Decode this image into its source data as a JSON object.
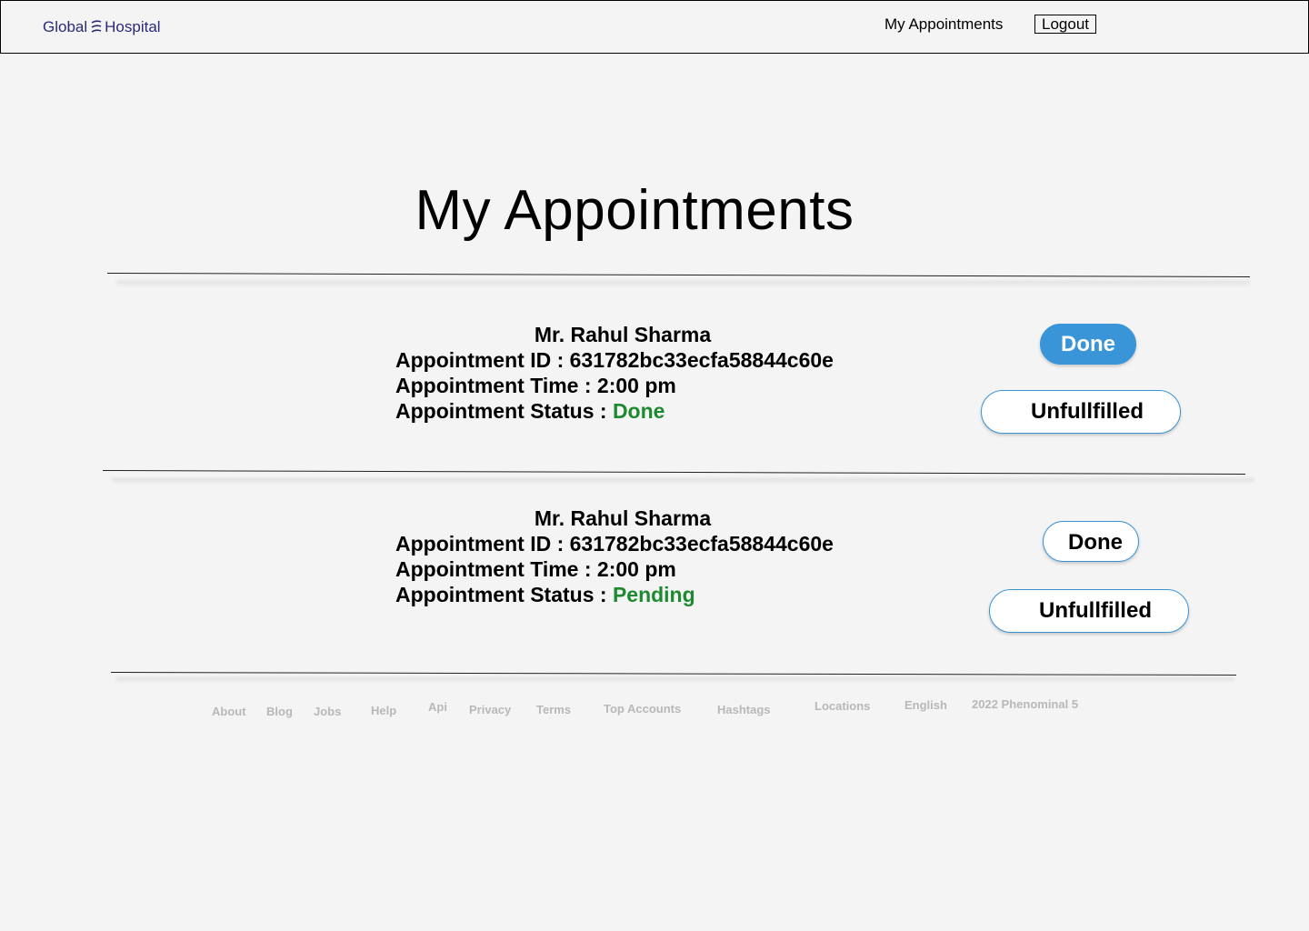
{
  "header": {
    "brand_left": "Global",
    "brand_right": "Hospital",
    "nav_link": "My Appointments",
    "logout_label": "Logout"
  },
  "page_title": "My Appointments",
  "appointments": [
    {
      "name": "Mr. Rahul Sharma",
      "id_label": "Appointment ID : ",
      "id_value": "631782bc33ecfa58844c60e",
      "time_label": "Appointment Time : ",
      "time_value": "2:00 pm",
      "status_label": "Appointment Status : ",
      "status_value": "Done",
      "done_label": "Done",
      "unfulfilled_label": "Unfullfilled"
    },
    {
      "name": "Mr. Rahul Sharma",
      "id_label": "Appointment ID : ",
      "id_value": "631782bc33ecfa58844c60e",
      "time_label": "Appointment Time : ",
      "time_value": "2:00 pm",
      "status_label": "Appointment Status : ",
      "status_value": "Pending",
      "done_label": "Done",
      "unfulfilled_label": "Unfullfilled"
    }
  ],
  "footer": {
    "links": [
      "About",
      "Blog",
      "Jobs",
      "Help",
      "Api",
      "Privacy",
      "Terms",
      "Top Accounts",
      "Hashtags",
      "Locations",
      "English"
    ],
    "copyright": "2022 Phenominal 5"
  },
  "colors": {
    "brand": "#2b2a7a",
    "accent": "#3a95d8",
    "status_green": "#1c8a2e",
    "footer_text": "#b8b8b8"
  },
  "icons": {
    "brand": "wave-lines-icon"
  }
}
